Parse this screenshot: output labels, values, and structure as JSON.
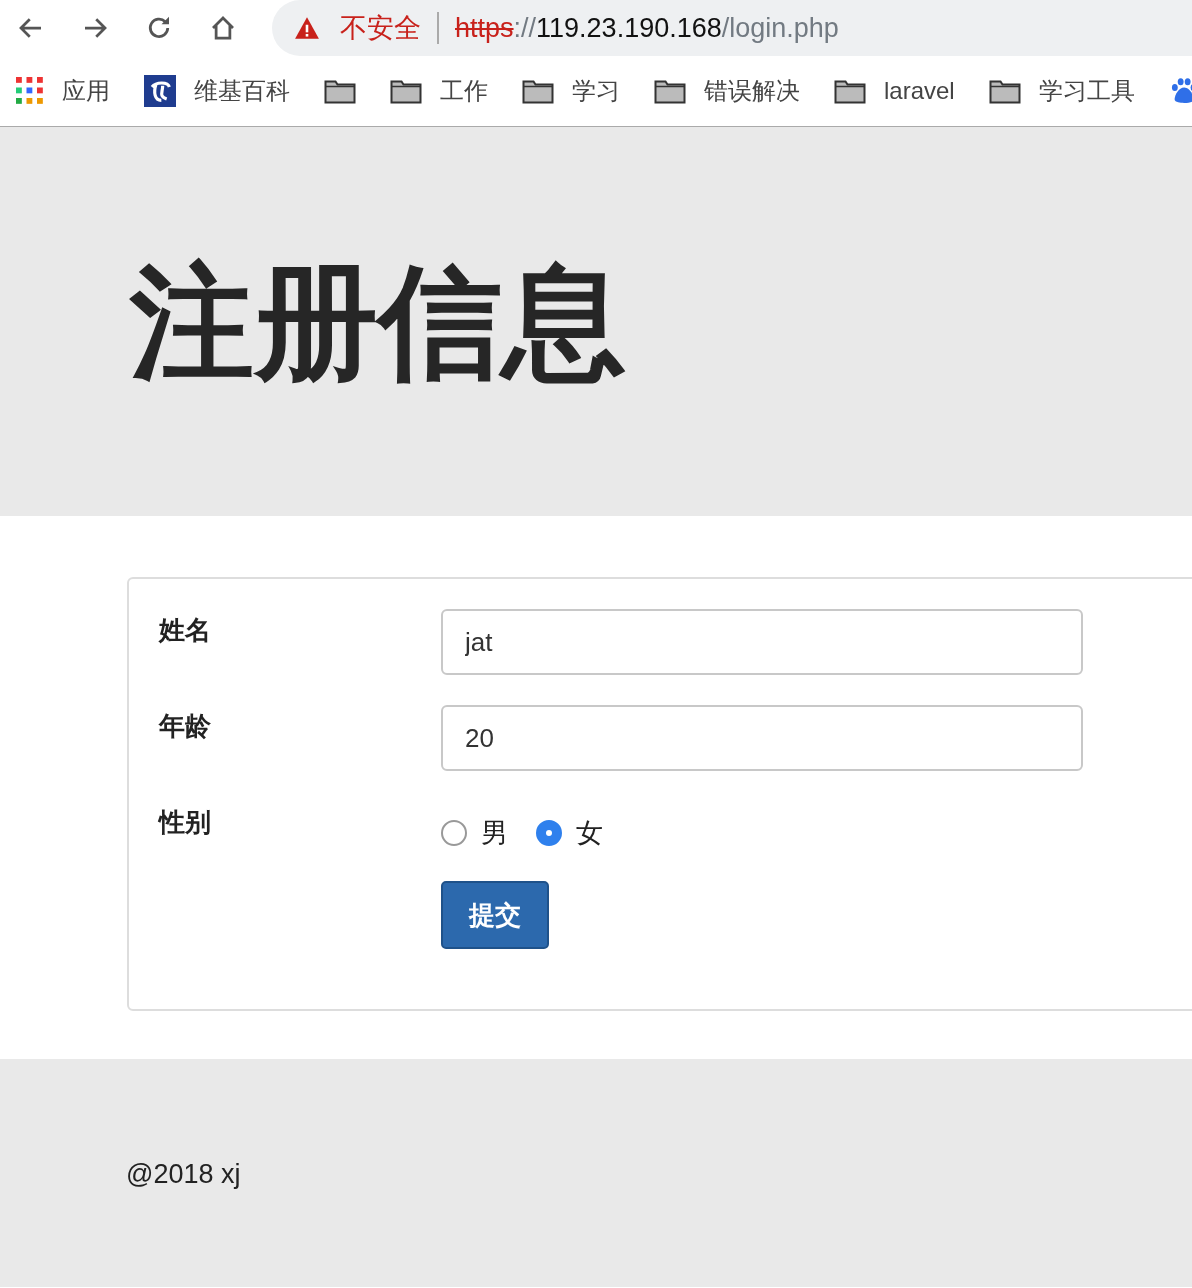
{
  "browser": {
    "security_label": "不安全",
    "url": [
      {
        "kind": "scheme",
        "text": "https"
      },
      {
        "kind": "sep",
        "text": "://"
      },
      {
        "kind": "host",
        "text": "119.23.190.168"
      },
      {
        "kind": "path",
        "text": "/login.php"
      }
    ]
  },
  "bookmarks": [
    {
      "kind": "apps",
      "label": "应用"
    },
    {
      "kind": "site",
      "label": "维基百科"
    },
    {
      "kind": "folder"
    },
    {
      "kind": "folder",
      "label": "工作"
    },
    {
      "kind": "folder",
      "label": "学习"
    },
    {
      "kind": "folder",
      "label": "错误解决"
    },
    {
      "kind": "folder",
      "label": "laravel"
    },
    {
      "kind": "folder",
      "label": "学习工具"
    },
    {
      "kind": "paw"
    }
  ],
  "page": {
    "heading": "注册信息",
    "form": {
      "fields": [
        {
          "kind": "text",
          "label": "姓名",
          "value": "jat"
        },
        {
          "kind": "text",
          "label": "年龄",
          "value": "20"
        },
        {
          "kind": "radio",
          "label": "性别",
          "options": [
            {
              "label": "男",
              "selected": false
            },
            {
              "label": "女",
              "selected": true
            }
          ]
        }
      ],
      "submit": "提交"
    },
    "footer": "@2018 xj"
  }
}
